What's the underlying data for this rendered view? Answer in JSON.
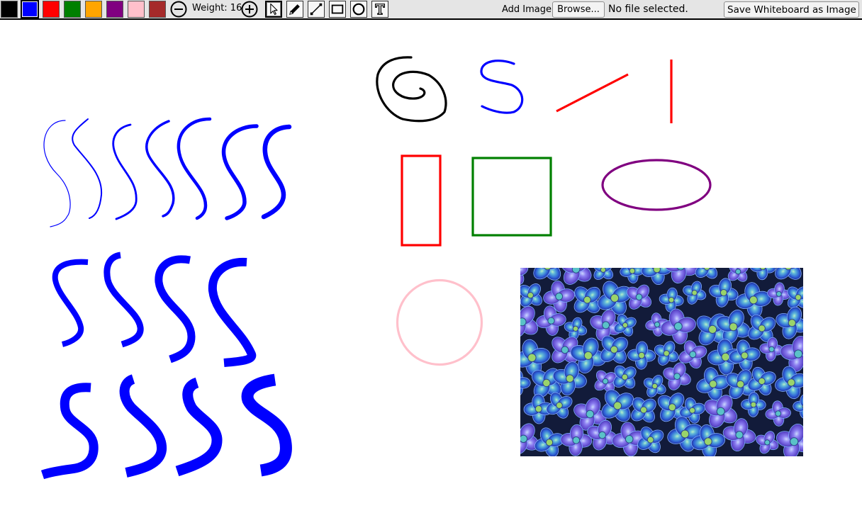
{
  "toolbar": {
    "colors": [
      {
        "name": "black",
        "hex": "#000000",
        "selected": false
      },
      {
        "name": "blue",
        "hex": "#0000ff",
        "selected": true
      },
      {
        "name": "red",
        "hex": "#ff0000",
        "selected": false
      },
      {
        "name": "green",
        "hex": "#008000",
        "selected": false
      },
      {
        "name": "orange",
        "hex": "#ffa500",
        "selected": false
      },
      {
        "name": "purple",
        "hex": "#800080",
        "selected": false
      },
      {
        "name": "pink",
        "hex": "#ffc0cb",
        "selected": false
      },
      {
        "name": "brown",
        "hex": "#a52a2a",
        "selected": false
      }
    ],
    "weight_label": "Weight: 16",
    "decrease_icon": "minus-circle-icon",
    "increase_icon": "plus-circle-icon",
    "tools": [
      {
        "name": "select",
        "icon": "cursor-icon",
        "active": true
      },
      {
        "name": "pencil",
        "icon": "pencil-icon",
        "active": false
      },
      {
        "name": "line",
        "icon": "line-icon",
        "active": false
      },
      {
        "name": "rectangle",
        "icon": "rectangle-icon",
        "active": false
      },
      {
        "name": "ellipse",
        "icon": "circle-icon",
        "active": false
      },
      {
        "name": "text",
        "icon": "text-icon",
        "active": false
      }
    ],
    "add_image_label": "Add Image:",
    "browse_label": "Browse...",
    "file_status": "No file selected.",
    "save_label": "Save Whiteboard as Image"
  },
  "canvas": {
    "background": "#ffffff",
    "stroke_colors": {
      "freehand_black": "#000000",
      "freehand_blue": "#0000ff",
      "line": "#ff0000",
      "rect_red": "#ff0000",
      "rect_green": "#008000",
      "ellipse": "#800080",
      "circle": "#ffc0cb"
    },
    "image": {
      "description_icon": "hydrangea-photo"
    }
  }
}
